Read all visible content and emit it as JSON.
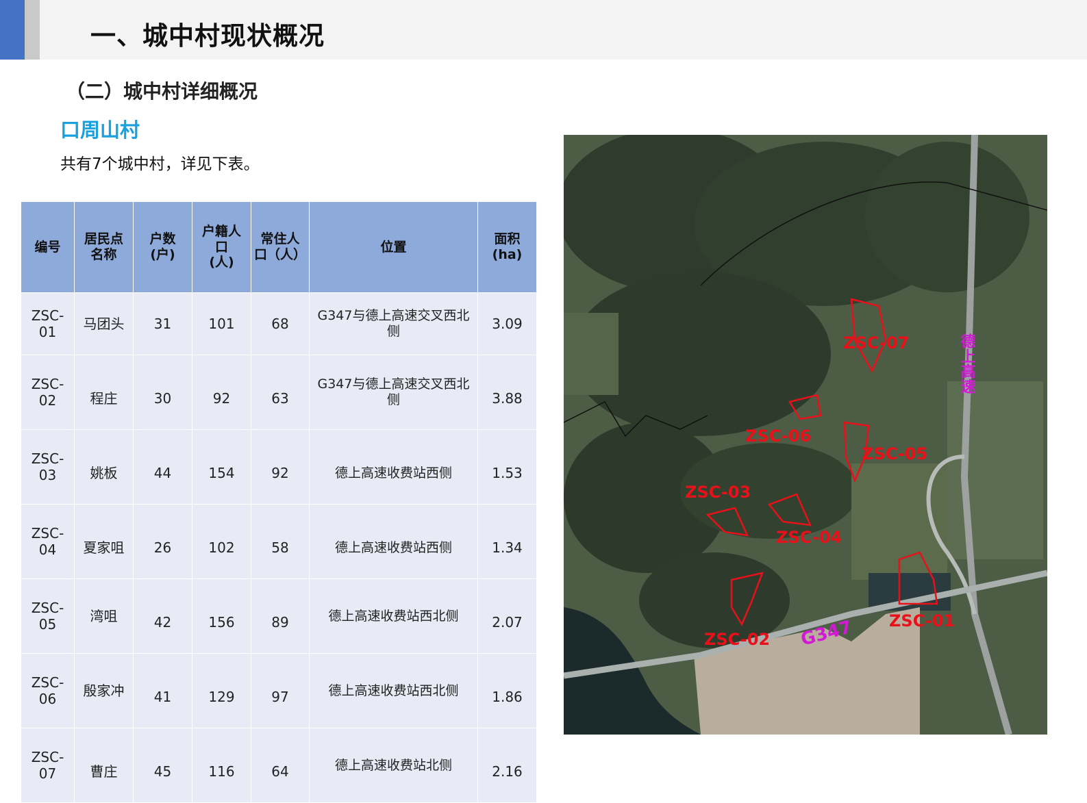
{
  "header": {
    "title": "一、城中村现状概况"
  },
  "section": {
    "title": "（二）城中村详细概况"
  },
  "village": {
    "title": "口周山村"
  },
  "intro": {
    "text": "共有7个城中村，详见下表。"
  },
  "table": {
    "headers": [
      "编号",
      "居民点名称",
      "户数（户）",
      "户籍人口（人）",
      "常住人口（人）",
      "位置",
      "面积(ha)"
    ],
    "header_lines": [
      [
        "编号"
      ],
      [
        "居民点",
        "名称"
      ],
      [
        "户数",
        "(户)"
      ],
      [
        "户籍人",
        "口",
        "(人)"
      ],
      [
        "常住人",
        "口（人）"
      ],
      [
        "位置"
      ],
      [
        "面积",
        "(ha)"
      ]
    ],
    "rows": [
      {
        "id": [
          "ZSC-",
          "01"
        ],
        "name": "马团头",
        "households": "31",
        "registered": "101",
        "resident": "68",
        "location": [
          "G347与德上高速交叉西北",
          "侧"
        ],
        "area": "3.09"
      },
      {
        "id": [
          "ZSC-",
          "02"
        ],
        "name": "程庄",
        "households": "30",
        "registered": "92",
        "resident": "63",
        "location": [
          "G347与德上高速交叉西北",
          "侧"
        ],
        "area": "3.88"
      },
      {
        "id": [
          "ZSC-",
          "03"
        ],
        "name": "姚板",
        "households": "44",
        "registered": "154",
        "resident": "92",
        "location": [
          "德上高速收费站西侧"
        ],
        "area": "1.53"
      },
      {
        "id": [
          "ZSC-",
          "04"
        ],
        "name": "夏家咀",
        "households": "26",
        "registered": "102",
        "resident": "58",
        "location": [
          "德上高速收费站西侧"
        ],
        "area": "1.34"
      },
      {
        "id": [
          "ZSC-",
          "05"
        ],
        "name": "湾咀",
        "households": "42",
        "registered": "156",
        "resident": "89",
        "location": [
          "德上高速收费站西北侧"
        ],
        "area": "2.07"
      },
      {
        "id": [
          "ZSC-",
          "06"
        ],
        "name": "殷家冲",
        "households": "41",
        "registered": "129",
        "resident": "97",
        "location": [
          "德上高速收费站西北侧"
        ],
        "area": "1.86"
      },
      {
        "id": [
          "ZSC-",
          "07"
        ],
        "name": "曹庄",
        "households": "45",
        "registered": "116",
        "resident": "64",
        "location": [
          "德上高速收费站北侧"
        ],
        "area": "2.16"
      }
    ]
  },
  "map": {
    "labels": [
      "ZSC-01",
      "ZSC-02",
      "ZSC-03",
      "ZSC-04",
      "ZSC-05",
      "ZSC-06",
      "ZSC-07"
    ],
    "road_labels": [
      "G347",
      "德上高速"
    ],
    "label_color": "#e8111a",
    "road_label_color": "#d21ad6"
  }
}
